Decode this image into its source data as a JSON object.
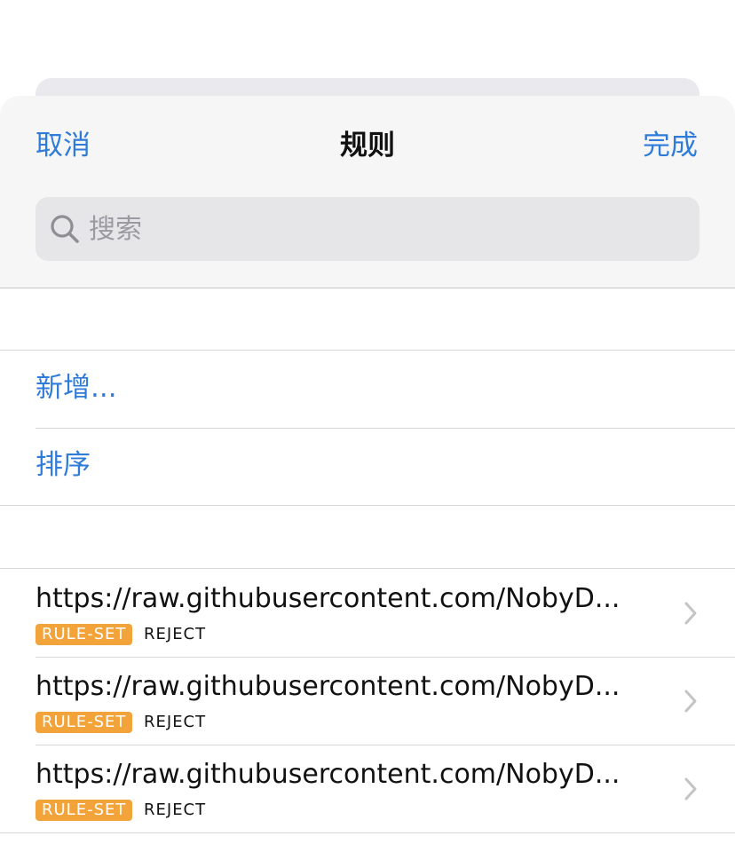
{
  "navbar": {
    "cancel_label": "取消",
    "title": "规则",
    "done_label": "完成"
  },
  "search": {
    "placeholder": "搜索",
    "value": ""
  },
  "actions": [
    {
      "label": "新增..."
    },
    {
      "label": "排序"
    }
  ],
  "rules": [
    {
      "url": "https://raw.githubusercontent.com/NobyD...",
      "type": "RULE-SET",
      "policy": "REJECT"
    },
    {
      "url": "https://raw.githubusercontent.com/NobyD...",
      "type": "RULE-SET",
      "policy": "REJECT"
    },
    {
      "url": "https://raw.githubusercontent.com/NobyD...",
      "type": "RULE-SET",
      "policy": "REJECT"
    }
  ],
  "colors": {
    "accent": "#2f7bd8",
    "tag": "#f2a33a"
  }
}
